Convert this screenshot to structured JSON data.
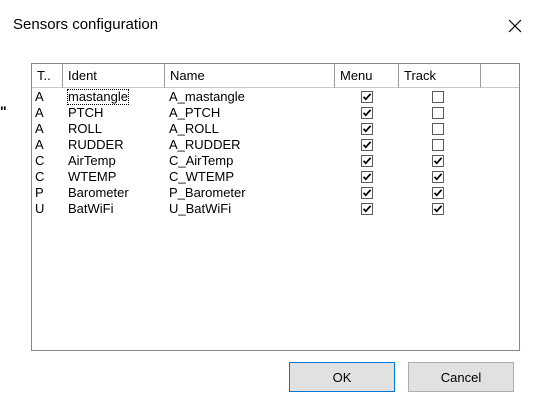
{
  "window": {
    "title": "Sensors configuration",
    "stray_mark": "\""
  },
  "table": {
    "columns": [
      "T..",
      "Ident",
      "Name",
      "Menu",
      "Track"
    ],
    "rows": [
      {
        "type": "A",
        "ident": "mastangle",
        "name": "A_mastangle",
        "menu": true,
        "track": false
      },
      {
        "type": "A",
        "ident": "PTCH",
        "name": "A_PTCH",
        "menu": true,
        "track": false
      },
      {
        "type": "A",
        "ident": "ROLL",
        "name": "A_ROLL",
        "menu": true,
        "track": false
      },
      {
        "type": "A",
        "ident": "RUDDER",
        "name": "A_RUDDER",
        "menu": true,
        "track": false
      },
      {
        "type": "C",
        "ident": "AirTemp",
        "name": "C_AirTemp",
        "menu": true,
        "track": true
      },
      {
        "type": "C",
        "ident": "WTEMP",
        "name": "C_WTEMP",
        "menu": true,
        "track": true
      },
      {
        "type": "P",
        "ident": "Barometer",
        "name": "P_Barometer",
        "menu": true,
        "track": true
      },
      {
        "type": "U",
        "ident": "BatWiFi",
        "name": "U_BatWiFi",
        "menu": true,
        "track": true
      }
    ]
  },
  "buttons": {
    "ok_label": "OK",
    "cancel_label": "Cancel"
  },
  "icons": {
    "close": "close-icon",
    "check": "checkmark-icon"
  }
}
